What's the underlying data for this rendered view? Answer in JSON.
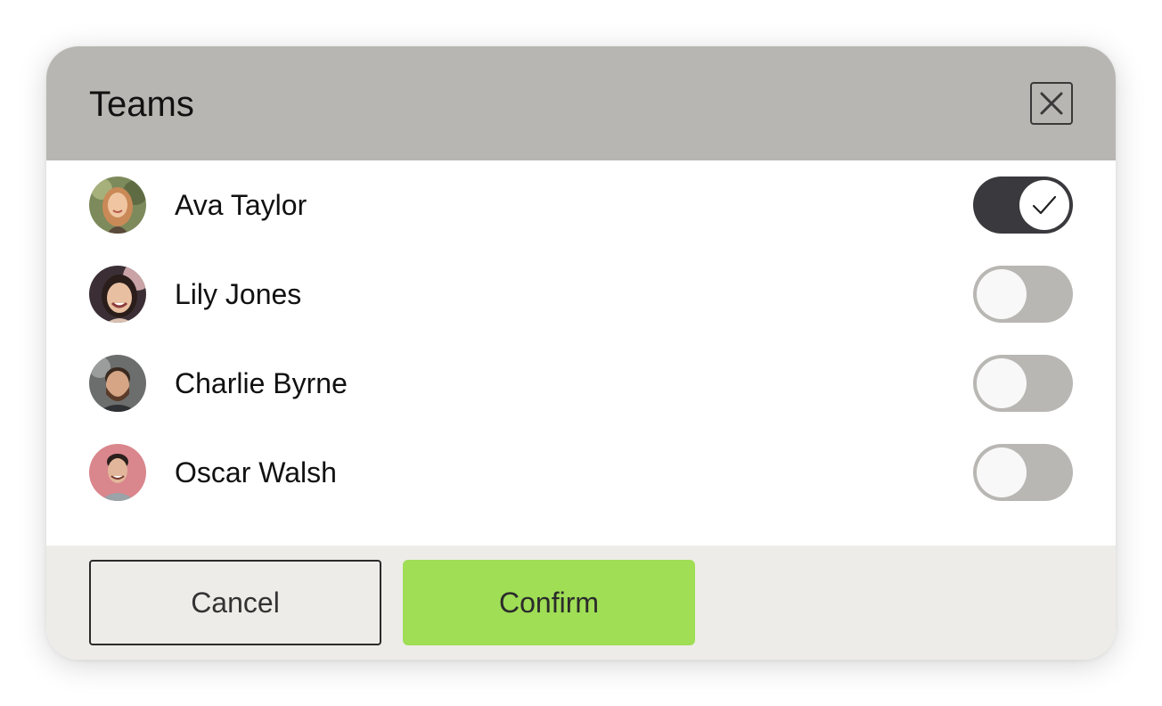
{
  "dialog": {
    "title": "Teams",
    "close_icon": "close-icon"
  },
  "members": [
    {
      "name": "Ava Taylor",
      "selected": true
    },
    {
      "name": "Lily Jones",
      "selected": false
    },
    {
      "name": "Charlie Byrne",
      "selected": false
    },
    {
      "name": "Oscar Walsh",
      "selected": false
    }
  ],
  "footer": {
    "cancel_label": "Cancel",
    "confirm_label": "Confirm"
  },
  "colors": {
    "header_bg": "#b7b6b2",
    "toggle_on": "#3a393d",
    "toggle_off": "#b8b7b3",
    "confirm_bg": "#9fde55",
    "footer_bg": "#edece8"
  }
}
